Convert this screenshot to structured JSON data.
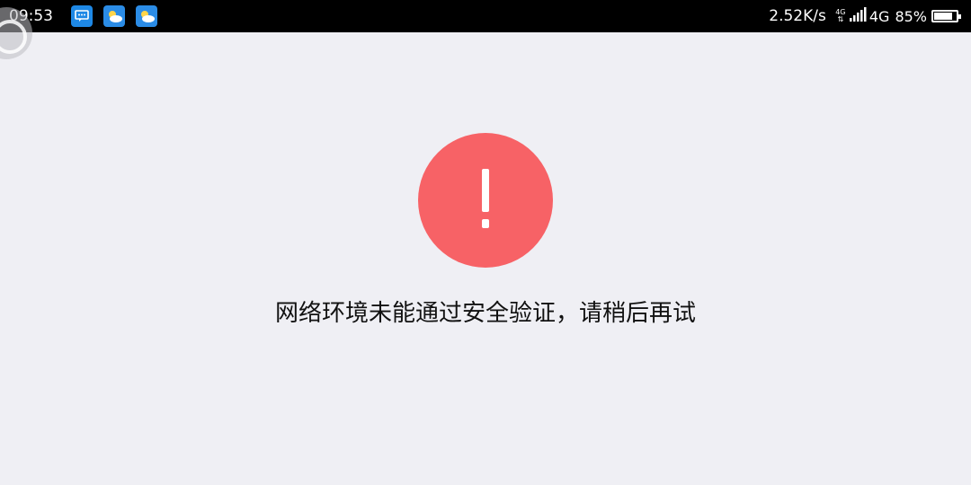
{
  "statusbar": {
    "time": "09:53",
    "speed": "2.52K/s",
    "network_small": "4G",
    "network": "4G",
    "battery_pct": "85%",
    "battery_level": 0.85,
    "icons": [
      "message-icon",
      "weather-icon",
      "weather-icon"
    ]
  },
  "error": {
    "icon": "exclamation-icon",
    "color": "#f76266",
    "message": "网络环境未能通过安全验证，请稍后再试"
  }
}
